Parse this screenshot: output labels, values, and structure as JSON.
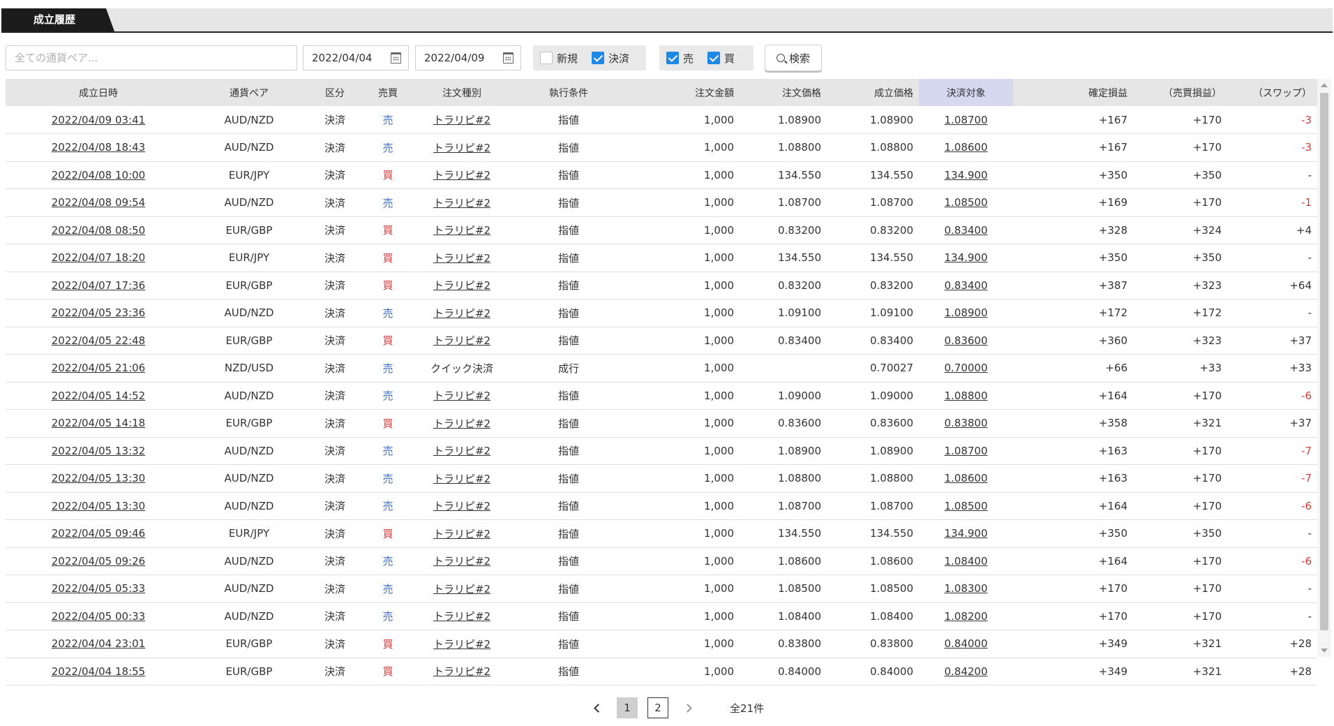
{
  "tab": {
    "label": "成立履歴"
  },
  "filters": {
    "pair_placeholder": "全ての通貨ペア...",
    "date_from": "2022/04/04",
    "date_to": "2022/04/09",
    "new_label": "新規",
    "new_checked": false,
    "settle_label": "決済",
    "settle_checked": true,
    "sell_label": "売",
    "sell_checked": true,
    "buy_label": "買",
    "buy_checked": true,
    "search_label": "検索"
  },
  "table": {
    "headers": [
      "成立日時",
      "通貨ペア",
      "区分",
      "売買",
      "注文種別",
      "執行条件",
      "注文金額",
      "注文価格",
      "成立価格",
      "決済対象",
      "確定損益",
      "（売買損益）",
      "（スワップ）"
    ],
    "rows": [
      [
        "2022/04/09 03:41",
        "AUD/NZD",
        "決済",
        "売",
        "トラリピ#2",
        "指値",
        "1,000",
        "1.08900",
        "1.08900",
        "1.08700",
        "+167",
        "+170",
        "-3"
      ],
      [
        "2022/04/08 18:43",
        "AUD/NZD",
        "決済",
        "売",
        "トラリピ#2",
        "指値",
        "1,000",
        "1.08800",
        "1.08800",
        "1.08600",
        "+167",
        "+170",
        "-3"
      ],
      [
        "2022/04/08 10:00",
        "EUR/JPY",
        "決済",
        "買",
        "トラリピ#2",
        "指値",
        "1,000",
        "134.550",
        "134.550",
        "134.900",
        "+350",
        "+350",
        "-"
      ],
      [
        "2022/04/08 09:54",
        "AUD/NZD",
        "決済",
        "売",
        "トラリピ#2",
        "指値",
        "1,000",
        "1.08700",
        "1.08700",
        "1.08500",
        "+169",
        "+170",
        "-1"
      ],
      [
        "2022/04/08 08:50",
        "EUR/GBP",
        "決済",
        "買",
        "トラリピ#2",
        "指値",
        "1,000",
        "0.83200",
        "0.83200",
        "0.83400",
        "+328",
        "+324",
        "+4"
      ],
      [
        "2022/04/07 18:20",
        "EUR/JPY",
        "決済",
        "買",
        "トラリピ#2",
        "指値",
        "1,000",
        "134.550",
        "134.550",
        "134.900",
        "+350",
        "+350",
        "-"
      ],
      [
        "2022/04/07 17:36",
        "EUR/GBP",
        "決済",
        "買",
        "トラリピ#2",
        "指値",
        "1,000",
        "0.83200",
        "0.83200",
        "0.83400",
        "+387",
        "+323",
        "+64"
      ],
      [
        "2022/04/05 23:36",
        "AUD/NZD",
        "決済",
        "売",
        "トラリピ#2",
        "指値",
        "1,000",
        "1.09100",
        "1.09100",
        "1.08900",
        "+172",
        "+172",
        "-"
      ],
      [
        "2022/04/05 22:48",
        "EUR/GBP",
        "決済",
        "買",
        "トラリピ#2",
        "指値",
        "1,000",
        "0.83400",
        "0.83400",
        "0.83600",
        "+360",
        "+323",
        "+37"
      ],
      [
        "2022/04/05 21:06",
        "NZD/USD",
        "決済",
        "売",
        "クイック決済",
        "成行",
        "1,000",
        "",
        "0.70027",
        "0.70000",
        "+66",
        "+33",
        "+33"
      ],
      [
        "2022/04/05 14:52",
        "AUD/NZD",
        "決済",
        "売",
        "トラリピ#2",
        "指値",
        "1,000",
        "1.09000",
        "1.09000",
        "1.08800",
        "+164",
        "+170",
        "-6"
      ],
      [
        "2022/04/05 14:18",
        "EUR/GBP",
        "決済",
        "買",
        "トラリピ#2",
        "指値",
        "1,000",
        "0.83600",
        "0.83600",
        "0.83800",
        "+358",
        "+321",
        "+37"
      ],
      [
        "2022/04/05 13:32",
        "AUD/NZD",
        "決済",
        "売",
        "トラリピ#2",
        "指値",
        "1,000",
        "1.08900",
        "1.08900",
        "1.08700",
        "+163",
        "+170",
        "-7"
      ],
      [
        "2022/04/05 13:30",
        "AUD/NZD",
        "決済",
        "売",
        "トラリピ#2",
        "指値",
        "1,000",
        "1.08800",
        "1.08800",
        "1.08600",
        "+163",
        "+170",
        "-7"
      ],
      [
        "2022/04/05 13:30",
        "AUD/NZD",
        "決済",
        "売",
        "トラリピ#2",
        "指値",
        "1,000",
        "1.08700",
        "1.08700",
        "1.08500",
        "+164",
        "+170",
        "-6"
      ],
      [
        "2022/04/05 09:46",
        "EUR/JPY",
        "決済",
        "買",
        "トラリピ#2",
        "指値",
        "1,000",
        "134.550",
        "134.550",
        "134.900",
        "+350",
        "+350",
        "-"
      ],
      [
        "2022/04/05 09:26",
        "AUD/NZD",
        "決済",
        "売",
        "トラリピ#2",
        "指値",
        "1,000",
        "1.08600",
        "1.08600",
        "1.08400",
        "+164",
        "+170",
        "-6"
      ],
      [
        "2022/04/05 05:33",
        "AUD/NZD",
        "決済",
        "売",
        "トラリピ#2",
        "指値",
        "1,000",
        "1.08500",
        "1.08500",
        "1.08300",
        "+170",
        "+170",
        "-"
      ],
      [
        "2022/04/05 00:33",
        "AUD/NZD",
        "決済",
        "売",
        "トラリピ#2",
        "指値",
        "1,000",
        "1.08400",
        "1.08400",
        "1.08200",
        "+170",
        "+170",
        "-"
      ],
      [
        "2022/04/04 23:01",
        "EUR/GBP",
        "決済",
        "買",
        "トラリピ#2",
        "指値",
        "1,000",
        "0.83800",
        "0.83800",
        "0.84000",
        "+349",
        "+321",
        "+28"
      ],
      [
        "2022/04/04 18:55",
        "EUR/GBP",
        "決済",
        "買",
        "トラリピ#2",
        "指値",
        "1,000",
        "0.84000",
        "0.84000",
        "0.84200",
        "+349",
        "+321",
        "+28"
      ]
    ]
  },
  "pagination": {
    "pages": [
      "1",
      "2"
    ],
    "current": "1",
    "total": "全21件"
  },
  "colors": {
    "sell": "#3a6fc4",
    "buy": "#d43c3c",
    "negative": "#d23c3c",
    "highlight_header": "#d5d8ef"
  }
}
